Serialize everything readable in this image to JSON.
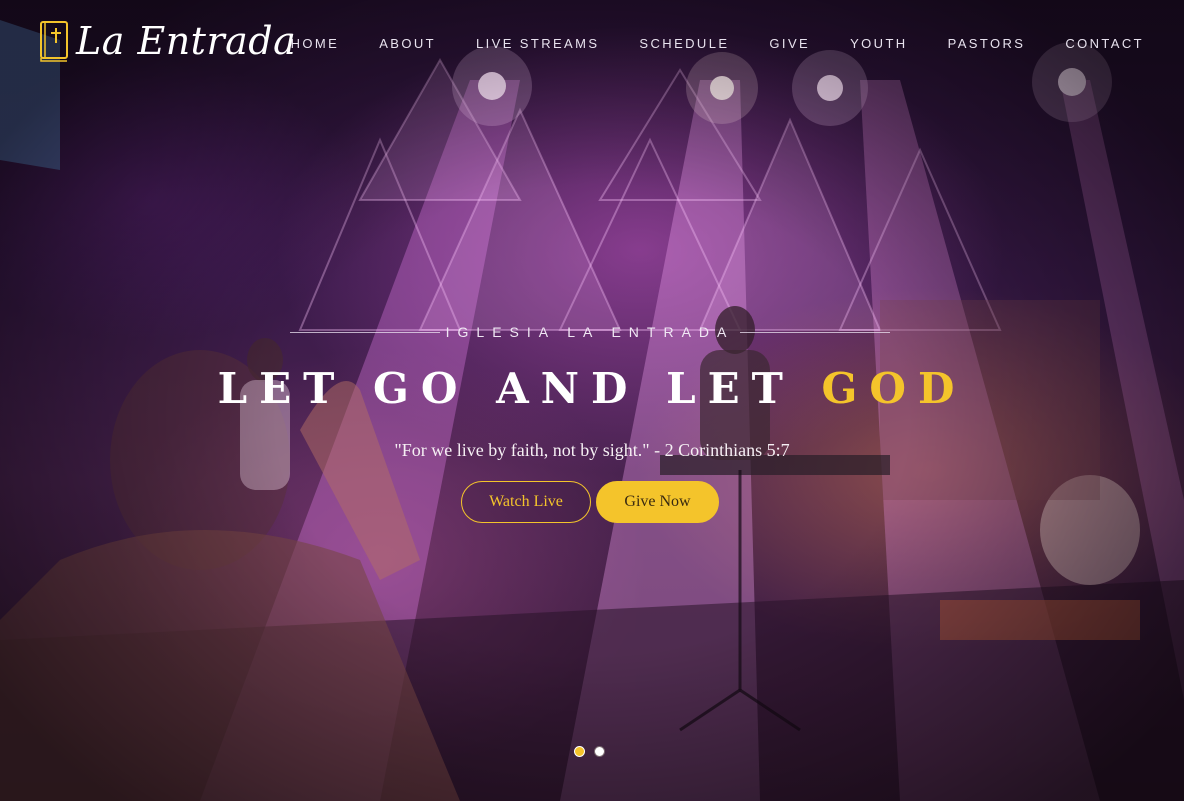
{
  "brand": {
    "name": "La Entrada",
    "accent_color": "#f4c42b",
    "logo_icon": "bible-cross-icon"
  },
  "nav": {
    "items": [
      {
        "label": "HOME"
      },
      {
        "label": "ABOUT"
      },
      {
        "label": "LIVE STREAMS"
      },
      {
        "label": "SCHEDULE"
      },
      {
        "label": "GIVE"
      },
      {
        "label": "YOUTH"
      },
      {
        "label": "PASTORS"
      },
      {
        "label": "CONTACT"
      }
    ]
  },
  "hero": {
    "eyebrow": "IGLESIA LA ENTRADA",
    "headline_main": "LET GO AND LET ",
    "headline_accent": "GOD",
    "verse": "\"For we live by faith, not by sight.\" - 2 Corinthians 5:7",
    "watch_button": "Watch Live",
    "give_button": "Give Now"
  },
  "slider": {
    "count": 2,
    "active": 1
  }
}
